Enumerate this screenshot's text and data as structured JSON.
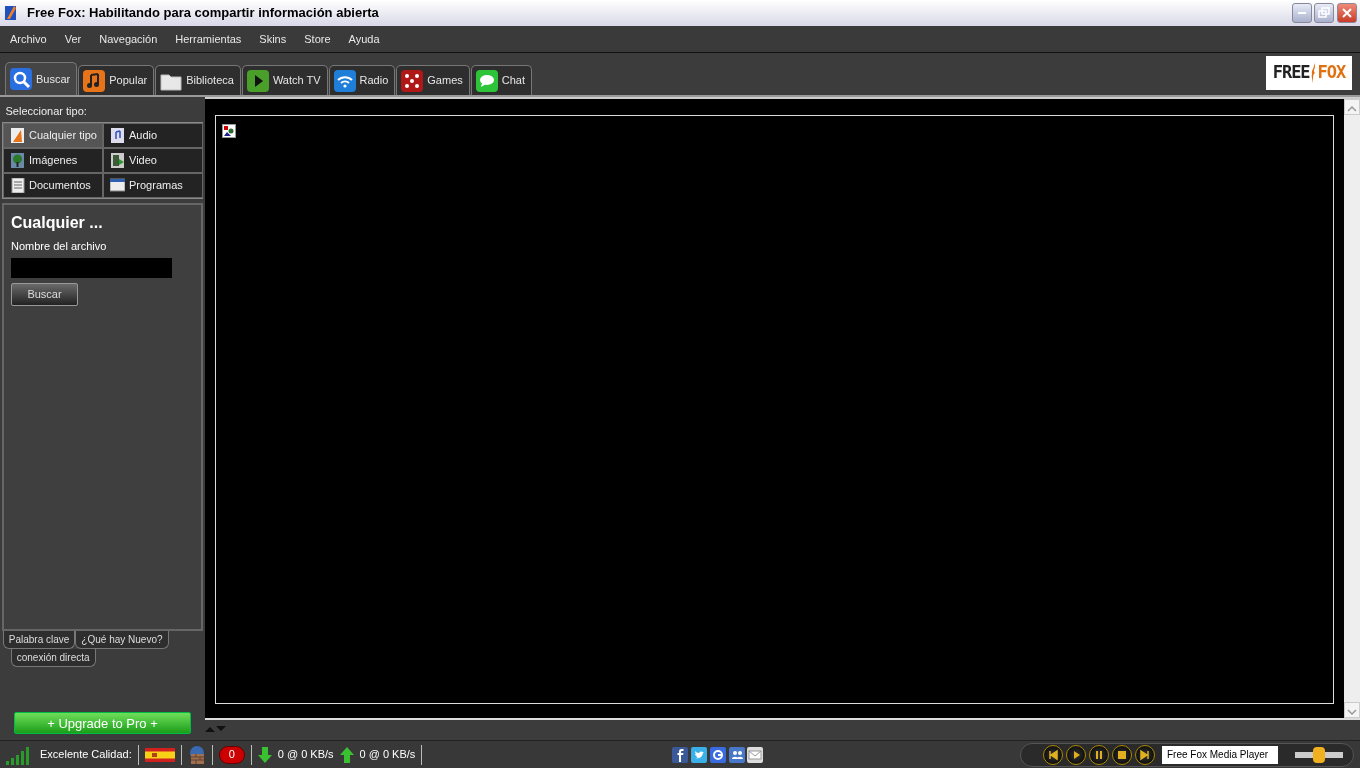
{
  "window": {
    "title": "Free Fox: Habilitando para compartir información abierta"
  },
  "menu": [
    "Archivo",
    "Ver",
    "Navegación",
    "Herramientas",
    "Skins",
    "Store",
    "Ayuda"
  ],
  "tabs": [
    {
      "label": "Buscar",
      "selected": true
    },
    {
      "label": "Popular",
      "selected": false
    },
    {
      "label": "Biblioteca",
      "selected": false
    },
    {
      "label": "Watch TV",
      "selected": false
    },
    {
      "label": "Radio",
      "selected": false
    },
    {
      "label": "Games",
      "selected": false
    },
    {
      "label": "Chat",
      "selected": false
    }
  ],
  "logo": {
    "left": "FREE",
    "right": "FOX"
  },
  "type_panel": {
    "heading": "Seleccionar tipo:",
    "types": [
      {
        "label": "Cualquier tipo",
        "selected": true
      },
      {
        "label": "Audio",
        "selected": false
      },
      {
        "label": "Imágenes",
        "selected": false
      },
      {
        "label": "Video",
        "selected": false
      },
      {
        "label": "Documentos",
        "selected": false
      },
      {
        "label": "Programas",
        "selected": false
      }
    ]
  },
  "search_form": {
    "title": "Cualquier ...",
    "field_label": "Nombre del archivo",
    "button": "Buscar"
  },
  "bottom_tabs": [
    "Palabra clave",
    "¿Qué hay Nuevo?",
    "conexión directa"
  ],
  "upgrade_button": "+ Upgrade to Pro +",
  "status_bar": {
    "quality": "Excelente Calidad:",
    "alerts": "0",
    "download": "0 @ 0 KB/s",
    "upload": "0 @ 0 KB/s"
  },
  "player": {
    "title": "Free Fox Media Player",
    "volume": {
      "level": 0.5
    }
  }
}
